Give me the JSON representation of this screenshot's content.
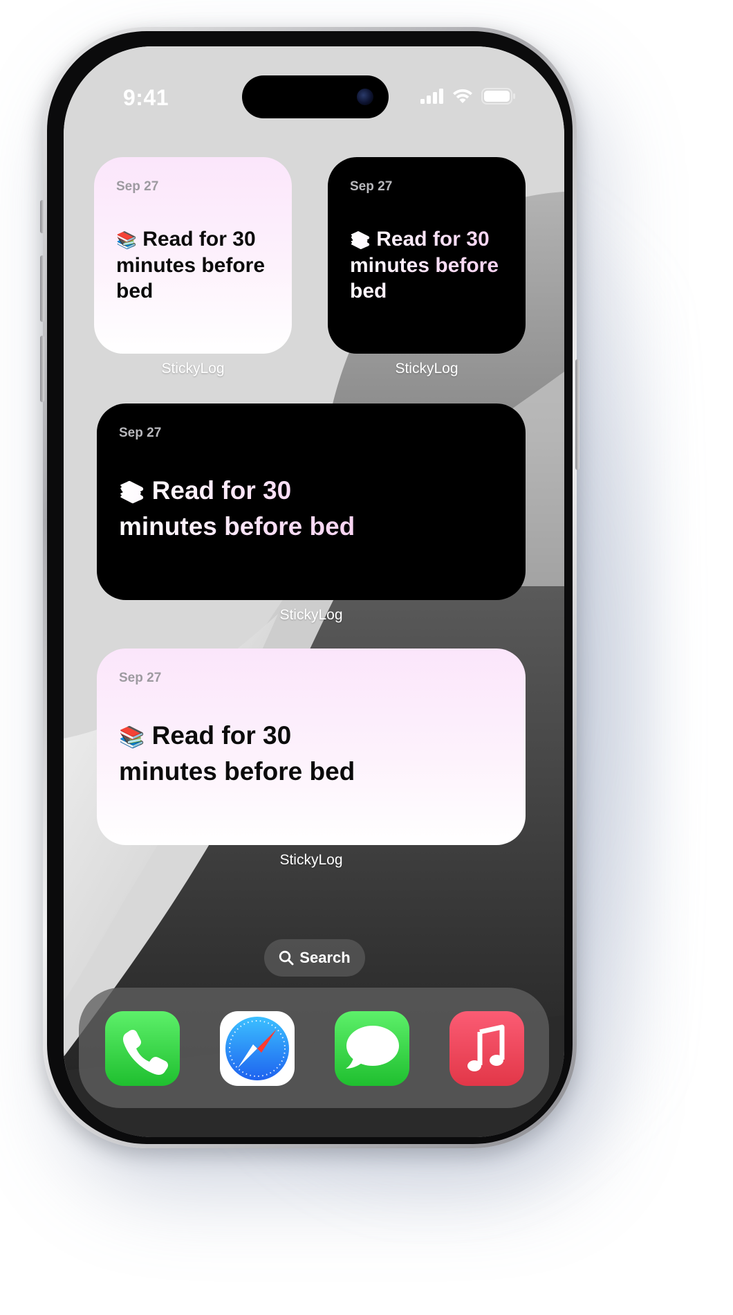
{
  "status_bar": {
    "time": "9:41",
    "icons": [
      "cellular-signal-icon",
      "wifi-icon",
      "battery-icon"
    ]
  },
  "widgets": [
    {
      "size": "small",
      "theme": "light",
      "date": "Sep 27",
      "emoji": "📚",
      "text": "Read for 30 minutes before bed",
      "app_label": "StickyLog"
    },
    {
      "size": "small",
      "theme": "dark",
      "date": "Sep 27",
      "emoji": "📚",
      "text": "Read for 30 minutes before bed",
      "app_label": "StickyLog"
    },
    {
      "size": "medium",
      "theme": "dark",
      "date": "Sep 27",
      "emoji": "📚",
      "text": "Read for 30 minutes before bed",
      "app_label": "StickyLog"
    },
    {
      "size": "medium",
      "theme": "light",
      "date": "Sep 27",
      "emoji": "📚",
      "text": "Read for 30 minutes before bed",
      "app_label": "StickyLog"
    }
  ],
  "search": {
    "label": "Search",
    "icon": "search-icon"
  },
  "dock": {
    "apps": [
      {
        "name": "Phone",
        "icon": "phone-app-icon"
      },
      {
        "name": "Safari",
        "icon": "safari-app-icon"
      },
      {
        "name": "Messages",
        "icon": "messages-app-icon"
      },
      {
        "name": "Music",
        "icon": "music-app-icon"
      }
    ]
  },
  "colors": {
    "widget_light_top": "#fbe6fb",
    "widget_dark": "#000000",
    "dark_text_tint": "#f6cdef",
    "phone_green": "#1fbf2f",
    "music_red": "#e23748",
    "safari_blue": "#1e7ef5"
  }
}
